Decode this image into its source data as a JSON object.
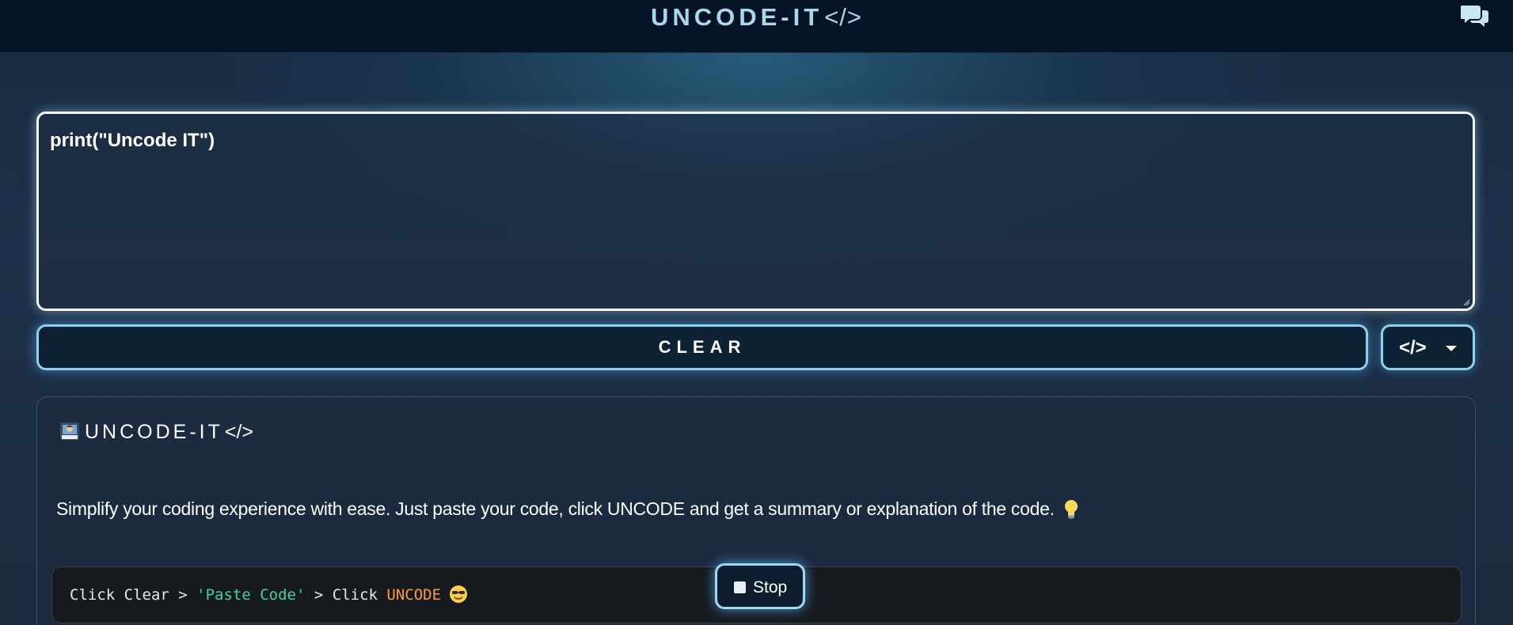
{
  "header": {
    "brand_name": "UNCODE-IT",
    "brand_tag": "</>",
    "chat_icon": "chat-bubbles-icon"
  },
  "editor": {
    "value": "print(\"Uncode IT\")"
  },
  "controls": {
    "clear_label": "CLEAR",
    "language_glyph": "</>",
    "language_caret_icon": "caret-down-icon"
  },
  "panel": {
    "title_emoji_icon": "technologist-emoji-icon",
    "title_name": "UNCODE-IT",
    "title_tag": "</>",
    "description": "Simplify your coding experience with ease. Just paste your code, click UNCODE and get a summary or explanation of the code.",
    "description_icon": "light-bulb-icon",
    "steps": {
      "part1": "Click Clear > ",
      "part2": "'Paste Code'",
      "part3": " > Click ",
      "part4": "UNCODE",
      "emoji_icon": "sunglasses-face-icon"
    }
  },
  "stop_button": {
    "label": "Stop",
    "icon": "stop-square-icon"
  },
  "colors": {
    "accent": "#8fd0ee",
    "brand": "#a9d7ee",
    "string_green": "#3fd39a",
    "keyword_orange": "#ff9b3a",
    "topbar_bg": "#051425"
  }
}
